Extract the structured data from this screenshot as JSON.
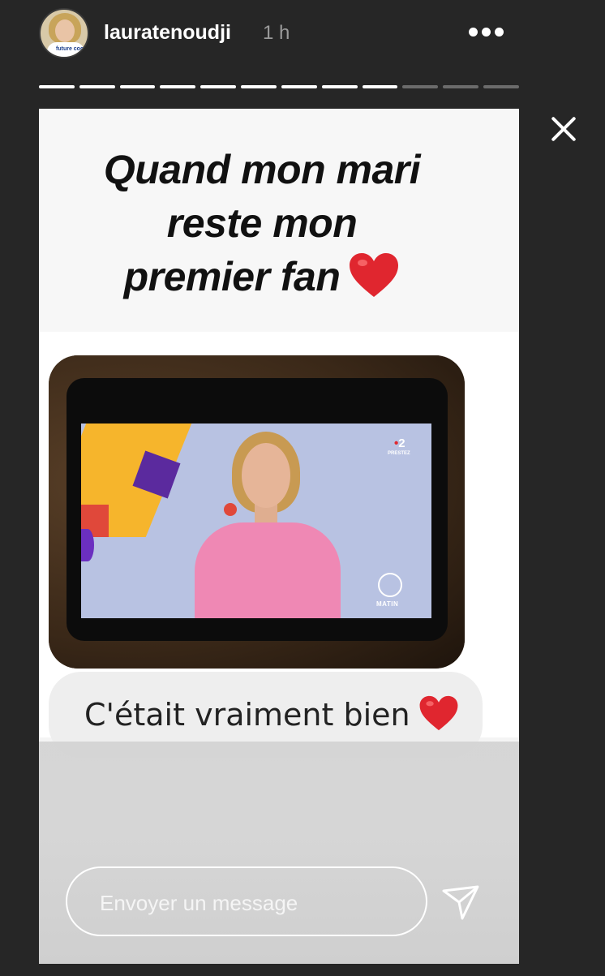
{
  "header": {
    "username": "lauratenoudji",
    "time": "1 h",
    "avatar_shirt_text": "future cool",
    "more_icon": "more-horizontal-icon"
  },
  "progress": {
    "total_segments": 12,
    "completed_segments": 9,
    "current_segment_fraction": 1.0
  },
  "story": {
    "caption_lines": [
      "Quand mon mari",
      "reste mon",
      "premier fan"
    ],
    "caption_emoji": "red-heart",
    "photo": {
      "channel_logo": "2",
      "channel_small_text": "PRESTEZ",
      "show_label": "MATIN"
    },
    "message_text": "C'était vraiment bien",
    "message_emoji": "red-heart"
  },
  "reply": {
    "placeholder": "Envoyer un message",
    "send_icon": "paper-plane-icon",
    "close_icon": "close-icon"
  },
  "colors": {
    "background": "#262626",
    "progress_done": "#ffffff",
    "progress_pending": "#6b6b6b",
    "heart": "#e0262f"
  }
}
